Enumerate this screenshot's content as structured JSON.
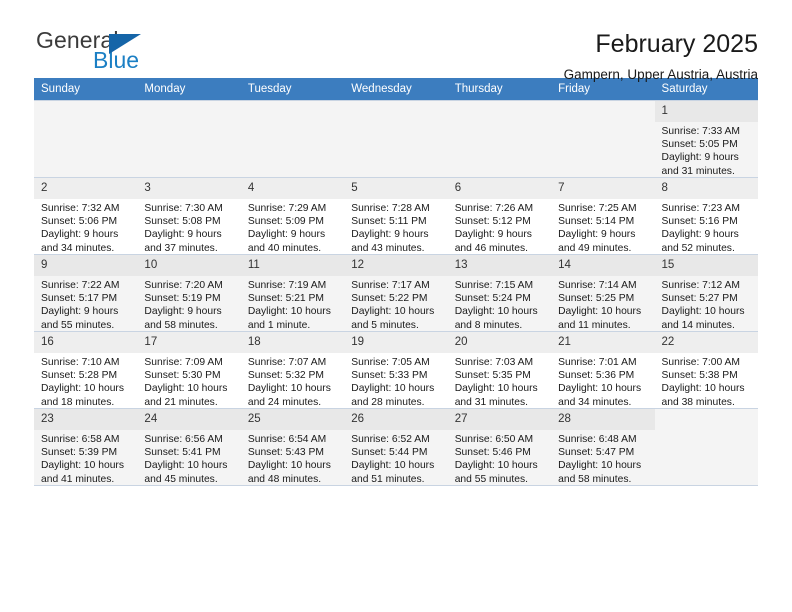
{
  "brand": {
    "name_top": "General",
    "name_bottom": "Blue",
    "accent_color": "#1565a8"
  },
  "header": {
    "title": "February 2025",
    "subtitle": "Gampern, Upper Austria, Austria"
  },
  "theme": {
    "header_row_color": "#3c7dbf",
    "band_row_color": "#f4f4f4",
    "grid_line_color": "#c9d4e2"
  },
  "weekdays": [
    "Sunday",
    "Monday",
    "Tuesday",
    "Wednesday",
    "Thursday",
    "Friday",
    "Saturday"
  ],
  "labels": {
    "sunrise_prefix": "Sunrise: ",
    "sunset_prefix": "Sunset: ",
    "daylight_prefix": "Daylight: "
  },
  "weeks": [
    [
      {
        "day": "",
        "lines": []
      },
      {
        "day": "",
        "lines": []
      },
      {
        "day": "",
        "lines": []
      },
      {
        "day": "",
        "lines": []
      },
      {
        "day": "",
        "lines": []
      },
      {
        "day": "",
        "lines": []
      },
      {
        "day": "1",
        "lines": [
          "Sunrise: 7:33 AM",
          "Sunset: 5:05 PM",
          "Daylight: 9 hours",
          "and 31 minutes."
        ]
      }
    ],
    [
      {
        "day": "2",
        "lines": [
          "Sunrise: 7:32 AM",
          "Sunset: 5:06 PM",
          "Daylight: 9 hours",
          "and 34 minutes."
        ]
      },
      {
        "day": "3",
        "lines": [
          "Sunrise: 7:30 AM",
          "Sunset: 5:08 PM",
          "Daylight: 9 hours",
          "and 37 minutes."
        ]
      },
      {
        "day": "4",
        "lines": [
          "Sunrise: 7:29 AM",
          "Sunset: 5:09 PM",
          "Daylight: 9 hours",
          "and 40 minutes."
        ]
      },
      {
        "day": "5",
        "lines": [
          "Sunrise: 7:28 AM",
          "Sunset: 5:11 PM",
          "Daylight: 9 hours",
          "and 43 minutes."
        ]
      },
      {
        "day": "6",
        "lines": [
          "Sunrise: 7:26 AM",
          "Sunset: 5:12 PM",
          "Daylight: 9 hours",
          "and 46 minutes."
        ]
      },
      {
        "day": "7",
        "lines": [
          "Sunrise: 7:25 AM",
          "Sunset: 5:14 PM",
          "Daylight: 9 hours",
          "and 49 minutes."
        ]
      },
      {
        "day": "8",
        "lines": [
          "Sunrise: 7:23 AM",
          "Sunset: 5:16 PM",
          "Daylight: 9 hours",
          "and 52 minutes."
        ]
      }
    ],
    [
      {
        "day": "9",
        "lines": [
          "Sunrise: 7:22 AM",
          "Sunset: 5:17 PM",
          "Daylight: 9 hours",
          "and 55 minutes."
        ]
      },
      {
        "day": "10",
        "lines": [
          "Sunrise: 7:20 AM",
          "Sunset: 5:19 PM",
          "Daylight: 9 hours",
          "and 58 minutes."
        ]
      },
      {
        "day": "11",
        "lines": [
          "Sunrise: 7:19 AM",
          "Sunset: 5:21 PM",
          "Daylight: 10 hours",
          "and 1 minute."
        ]
      },
      {
        "day": "12",
        "lines": [
          "Sunrise: 7:17 AM",
          "Sunset: 5:22 PM",
          "Daylight: 10 hours",
          "and 5 minutes."
        ]
      },
      {
        "day": "13",
        "lines": [
          "Sunrise: 7:15 AM",
          "Sunset: 5:24 PM",
          "Daylight: 10 hours",
          "and 8 minutes."
        ]
      },
      {
        "day": "14",
        "lines": [
          "Sunrise: 7:14 AM",
          "Sunset: 5:25 PM",
          "Daylight: 10 hours",
          "and 11 minutes."
        ]
      },
      {
        "day": "15",
        "lines": [
          "Sunrise: 7:12 AM",
          "Sunset: 5:27 PM",
          "Daylight: 10 hours",
          "and 14 minutes."
        ]
      }
    ],
    [
      {
        "day": "16",
        "lines": [
          "Sunrise: 7:10 AM",
          "Sunset: 5:28 PM",
          "Daylight: 10 hours",
          "and 18 minutes."
        ]
      },
      {
        "day": "17",
        "lines": [
          "Sunrise: 7:09 AM",
          "Sunset: 5:30 PM",
          "Daylight: 10 hours",
          "and 21 minutes."
        ]
      },
      {
        "day": "18",
        "lines": [
          "Sunrise: 7:07 AM",
          "Sunset: 5:32 PM",
          "Daylight: 10 hours",
          "and 24 minutes."
        ]
      },
      {
        "day": "19",
        "lines": [
          "Sunrise: 7:05 AM",
          "Sunset: 5:33 PM",
          "Daylight: 10 hours",
          "and 28 minutes."
        ]
      },
      {
        "day": "20",
        "lines": [
          "Sunrise: 7:03 AM",
          "Sunset: 5:35 PM",
          "Daylight: 10 hours",
          "and 31 minutes."
        ]
      },
      {
        "day": "21",
        "lines": [
          "Sunrise: 7:01 AM",
          "Sunset: 5:36 PM",
          "Daylight: 10 hours",
          "and 34 minutes."
        ]
      },
      {
        "day": "22",
        "lines": [
          "Sunrise: 7:00 AM",
          "Sunset: 5:38 PM",
          "Daylight: 10 hours",
          "and 38 minutes."
        ]
      }
    ],
    [
      {
        "day": "23",
        "lines": [
          "Sunrise: 6:58 AM",
          "Sunset: 5:39 PM",
          "Daylight: 10 hours",
          "and 41 minutes."
        ]
      },
      {
        "day": "24",
        "lines": [
          "Sunrise: 6:56 AM",
          "Sunset: 5:41 PM",
          "Daylight: 10 hours",
          "and 45 minutes."
        ]
      },
      {
        "day": "25",
        "lines": [
          "Sunrise: 6:54 AM",
          "Sunset: 5:43 PM",
          "Daylight: 10 hours",
          "and 48 minutes."
        ]
      },
      {
        "day": "26",
        "lines": [
          "Sunrise: 6:52 AM",
          "Sunset: 5:44 PM",
          "Daylight: 10 hours",
          "and 51 minutes."
        ]
      },
      {
        "day": "27",
        "lines": [
          "Sunrise: 6:50 AM",
          "Sunset: 5:46 PM",
          "Daylight: 10 hours",
          "and 55 minutes."
        ]
      },
      {
        "day": "28",
        "lines": [
          "Sunrise: 6:48 AM",
          "Sunset: 5:47 PM",
          "Daylight: 10 hours",
          "and 58 minutes."
        ]
      },
      {
        "day": "",
        "lines": []
      }
    ]
  ]
}
